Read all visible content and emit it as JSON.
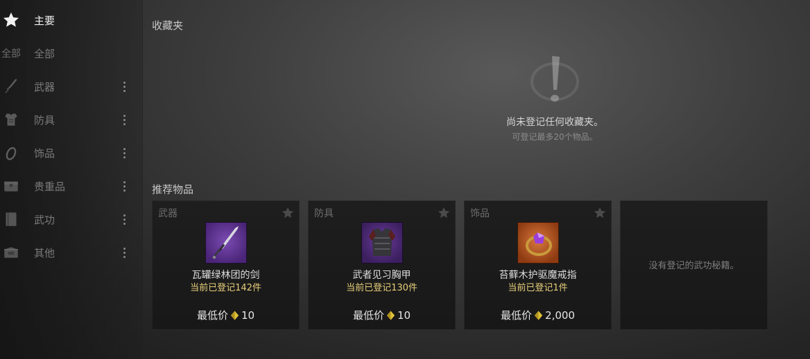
{
  "sidebar": {
    "items": [
      {
        "label": "主要",
        "icon": "star-icon"
      },
      {
        "label": "全部",
        "mini_label": "全部"
      },
      {
        "label": "武器",
        "icon": "sword-icon"
      },
      {
        "label": "防具",
        "icon": "armor-icon"
      },
      {
        "label": "饰品",
        "icon": "ring-icon"
      },
      {
        "label": "贵重品",
        "icon": "chest-icon"
      },
      {
        "label": "武功",
        "icon": "book-icon"
      },
      {
        "label": "其他",
        "icon": "box-icon"
      }
    ]
  },
  "favorites": {
    "title": "收藏夹",
    "empty_message": "尚未登记任何收藏夹。",
    "empty_hint": "可登记最多20个物品。"
  },
  "recommended": {
    "title": "推荐物品",
    "price_label": "最低价",
    "cards": [
      {
        "category": "武器",
        "name": "瓦罐绿林团的剑",
        "count": "当前已登记142件",
        "price": "10",
        "icon": "sword-item-icon"
      },
      {
        "category": "防具",
        "name": "武者见习胸甲",
        "count": "当前已登记130件",
        "price": "10",
        "icon": "chestplate-item-icon"
      },
      {
        "category": "饰品",
        "name": "苔藓木护驱魔戒指",
        "count": "当前已登记1件",
        "price": "2,000",
        "icon": "ring-item-icon"
      }
    ],
    "empty_card_text": "没有登记的武功秘籍。"
  },
  "colors": {
    "count_gold": "#e8cf7a",
    "rare_purple": "#5b2a8c",
    "accessory_orange": "#b8531e"
  }
}
